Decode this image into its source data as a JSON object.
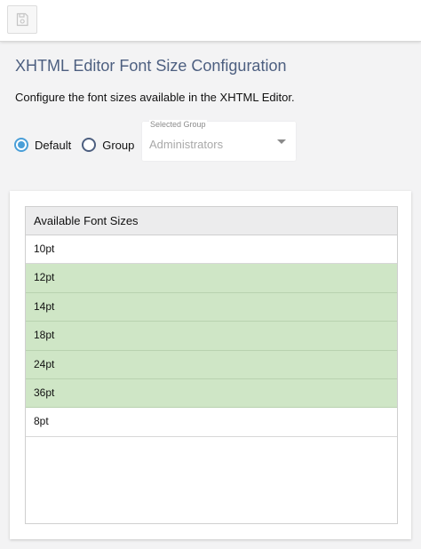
{
  "toolbar": {
    "save_icon": "save-icon"
  },
  "page": {
    "title": "XHTML Editor Font Size Configuration",
    "description": "Configure the font sizes available in the XHTML Editor."
  },
  "scope": {
    "options": [
      {
        "label": "Default",
        "checked": true
      },
      {
        "label": "Group",
        "checked": false
      }
    ],
    "group_select": {
      "caption": "Selected Group",
      "value": "Administrators"
    }
  },
  "font_list": {
    "header": "Available Font Sizes",
    "items": [
      {
        "label": "10pt",
        "selected": false
      },
      {
        "label": "12pt",
        "selected": true
      },
      {
        "label": "14pt",
        "selected": true
      },
      {
        "label": "18pt",
        "selected": true
      },
      {
        "label": "24pt",
        "selected": true
      },
      {
        "label": "36pt",
        "selected": true
      },
      {
        "label": "8pt",
        "selected": false
      }
    ]
  },
  "colors": {
    "accent": "#4a9fd8",
    "title": "#4d5f80",
    "selected_row": "#cfe6c6"
  }
}
